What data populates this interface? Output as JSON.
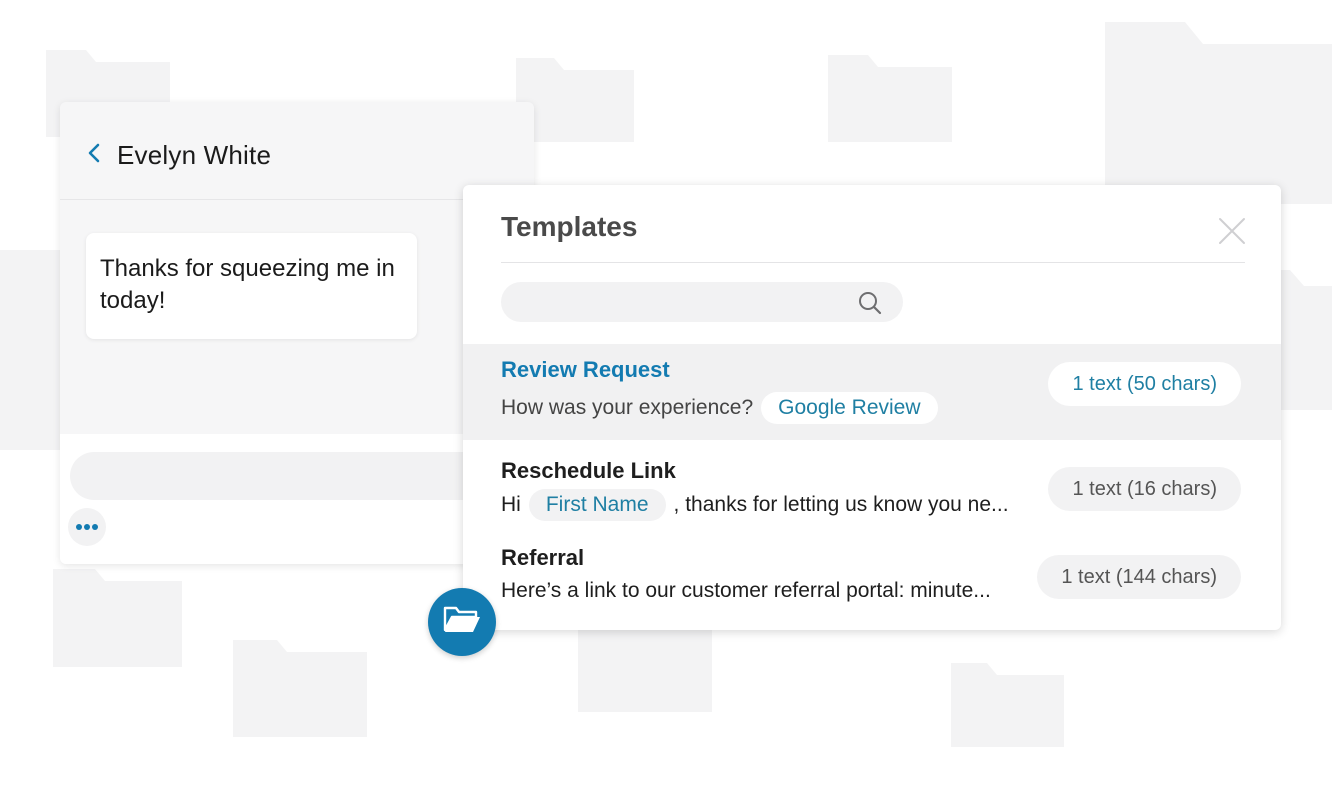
{
  "chat": {
    "contact_name": "Evelyn White",
    "message": "Thanks for squeezing me in today!",
    "back_icon": "chevron-left-icon",
    "more_icon": "ellipsis-icon"
  },
  "templates": {
    "title": "Templates",
    "close_icon": "close-icon",
    "search": {
      "placeholder": "",
      "icon": "search-icon"
    },
    "items": [
      {
        "title": "Review Request",
        "preview_text": "How was your experience?",
        "tag": "Google Review",
        "count": "1 text (50 chars)",
        "selected": true
      },
      {
        "title": "Reschedule Link",
        "preview_prefix": "Hi",
        "tag": "First Name",
        "preview_text": ", thanks for letting us know you ne...",
        "count": "1 text (16 chars)",
        "selected": false
      },
      {
        "title": "Referral",
        "preview_text": "Here’s a link to our customer referral portal: minute...",
        "count": "1 text (144 chars)",
        "selected": false
      }
    ]
  },
  "folder_button_icon": "folder-open-icon",
  "colors": {
    "accent": "#137bb1",
    "tag_text": "#1f7fa3",
    "panel_bg": "#ffffff",
    "selected_row_bg": "#f1f1f2",
    "background_folder": "#f3f3f4"
  }
}
